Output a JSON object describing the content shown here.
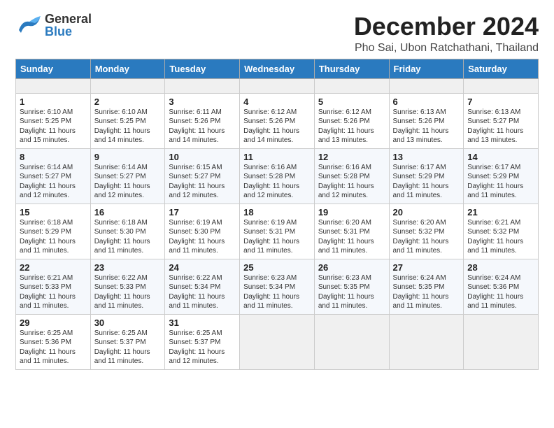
{
  "header": {
    "logo_general": "General",
    "logo_blue": "Blue",
    "title": "December 2024",
    "subtitle": "Pho Sai, Ubon Ratchathani, Thailand"
  },
  "calendar": {
    "days_of_week": [
      "Sunday",
      "Monday",
      "Tuesday",
      "Wednesday",
      "Thursday",
      "Friday",
      "Saturday"
    ],
    "weeks": [
      [
        {
          "day": "",
          "empty": true
        },
        {
          "day": "",
          "empty": true
        },
        {
          "day": "",
          "empty": true
        },
        {
          "day": "",
          "empty": true
        },
        {
          "day": "",
          "empty": true
        },
        {
          "day": "",
          "empty": true
        },
        {
          "day": "",
          "empty": true
        }
      ],
      [
        {
          "day": "1",
          "sunrise": "6:10 AM",
          "sunset": "5:25 PM",
          "daylight": "11 hours and 15 minutes."
        },
        {
          "day": "2",
          "sunrise": "6:10 AM",
          "sunset": "5:25 PM",
          "daylight": "11 hours and 14 minutes."
        },
        {
          "day": "3",
          "sunrise": "6:11 AM",
          "sunset": "5:26 PM",
          "daylight": "11 hours and 14 minutes."
        },
        {
          "day": "4",
          "sunrise": "6:12 AM",
          "sunset": "5:26 PM",
          "daylight": "11 hours and 14 minutes."
        },
        {
          "day": "5",
          "sunrise": "6:12 AM",
          "sunset": "5:26 PM",
          "daylight": "11 hours and 13 minutes."
        },
        {
          "day": "6",
          "sunrise": "6:13 AM",
          "sunset": "5:26 PM",
          "daylight": "11 hours and 13 minutes."
        },
        {
          "day": "7",
          "sunrise": "6:13 AM",
          "sunset": "5:27 PM",
          "daylight": "11 hours and 13 minutes."
        }
      ],
      [
        {
          "day": "8",
          "sunrise": "6:14 AM",
          "sunset": "5:27 PM",
          "daylight": "11 hours and 12 minutes."
        },
        {
          "day": "9",
          "sunrise": "6:14 AM",
          "sunset": "5:27 PM",
          "daylight": "11 hours and 12 minutes."
        },
        {
          "day": "10",
          "sunrise": "6:15 AM",
          "sunset": "5:27 PM",
          "daylight": "11 hours and 12 minutes."
        },
        {
          "day": "11",
          "sunrise": "6:16 AM",
          "sunset": "5:28 PM",
          "daylight": "11 hours and 12 minutes."
        },
        {
          "day": "12",
          "sunrise": "6:16 AM",
          "sunset": "5:28 PM",
          "daylight": "11 hours and 12 minutes."
        },
        {
          "day": "13",
          "sunrise": "6:17 AM",
          "sunset": "5:29 PM",
          "daylight": "11 hours and 11 minutes."
        },
        {
          "day": "14",
          "sunrise": "6:17 AM",
          "sunset": "5:29 PM",
          "daylight": "11 hours and 11 minutes."
        }
      ],
      [
        {
          "day": "15",
          "sunrise": "6:18 AM",
          "sunset": "5:29 PM",
          "daylight": "11 hours and 11 minutes."
        },
        {
          "day": "16",
          "sunrise": "6:18 AM",
          "sunset": "5:30 PM",
          "daylight": "11 hours and 11 minutes."
        },
        {
          "day": "17",
          "sunrise": "6:19 AM",
          "sunset": "5:30 PM",
          "daylight": "11 hours and 11 minutes."
        },
        {
          "day": "18",
          "sunrise": "6:19 AM",
          "sunset": "5:31 PM",
          "daylight": "11 hours and 11 minutes."
        },
        {
          "day": "19",
          "sunrise": "6:20 AM",
          "sunset": "5:31 PM",
          "daylight": "11 hours and 11 minutes."
        },
        {
          "day": "20",
          "sunrise": "6:20 AM",
          "sunset": "5:32 PM",
          "daylight": "11 hours and 11 minutes."
        },
        {
          "day": "21",
          "sunrise": "6:21 AM",
          "sunset": "5:32 PM",
          "daylight": "11 hours and 11 minutes."
        }
      ],
      [
        {
          "day": "22",
          "sunrise": "6:21 AM",
          "sunset": "5:33 PM",
          "daylight": "11 hours and 11 minutes."
        },
        {
          "day": "23",
          "sunrise": "6:22 AM",
          "sunset": "5:33 PM",
          "daylight": "11 hours and 11 minutes."
        },
        {
          "day": "24",
          "sunrise": "6:22 AM",
          "sunset": "5:34 PM",
          "daylight": "11 hours and 11 minutes."
        },
        {
          "day": "25",
          "sunrise": "6:23 AM",
          "sunset": "5:34 PM",
          "daylight": "11 hours and 11 minutes."
        },
        {
          "day": "26",
          "sunrise": "6:23 AM",
          "sunset": "5:35 PM",
          "daylight": "11 hours and 11 minutes."
        },
        {
          "day": "27",
          "sunrise": "6:24 AM",
          "sunset": "5:35 PM",
          "daylight": "11 hours and 11 minutes."
        },
        {
          "day": "28",
          "sunrise": "6:24 AM",
          "sunset": "5:36 PM",
          "daylight": "11 hours and 11 minutes."
        }
      ],
      [
        {
          "day": "29",
          "sunrise": "6:25 AM",
          "sunset": "5:36 PM",
          "daylight": "11 hours and 11 minutes."
        },
        {
          "day": "30",
          "sunrise": "6:25 AM",
          "sunset": "5:37 PM",
          "daylight": "11 hours and 11 minutes."
        },
        {
          "day": "31",
          "sunrise": "6:25 AM",
          "sunset": "5:37 PM",
          "daylight": "11 hours and 12 minutes."
        },
        {
          "day": "",
          "empty": true
        },
        {
          "day": "",
          "empty": true
        },
        {
          "day": "",
          "empty": true
        },
        {
          "day": "",
          "empty": true
        }
      ]
    ]
  }
}
